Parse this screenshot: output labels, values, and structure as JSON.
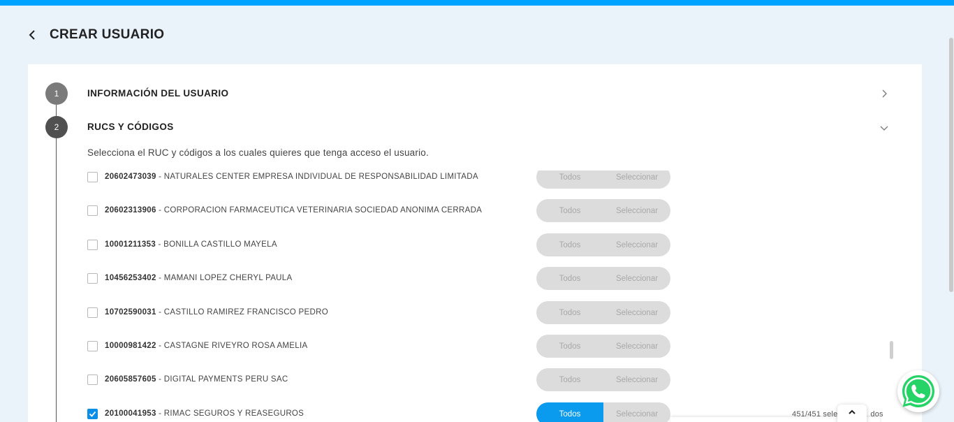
{
  "header": {
    "title": "CREAR USUARIO"
  },
  "steps": [
    {
      "number": "1",
      "title": "INFORMACIÓN DEL USUARIO"
    },
    {
      "number": "2",
      "title": "RUCS Y CÓDIGOS"
    }
  ],
  "rucs_section": {
    "description": "Selecciona el RUC y códigos a los cuales quieres que tenga acceso el usuario.",
    "toggle_labels": {
      "all": "Todos",
      "select": "Seleccionar"
    },
    "rows": [
      {
        "ruc": "20602473039",
        "name": " - NATURALES CENTER EMPRESA INDIVIDUAL DE RESPONSABILIDAD LIMITADA",
        "checked": false,
        "mode": ""
      },
      {
        "ruc": "20602313906",
        "name": " - CORPORACION FARMACEUTICA VETERINARIA SOCIEDAD ANONIMA CERRADA",
        "checked": false,
        "mode": ""
      },
      {
        "ruc": "10001211353",
        "name": " - BONILLA CASTILLO MAYELA",
        "checked": false,
        "mode": ""
      },
      {
        "ruc": "10456253402",
        "name": " - MAMANI LOPEZ CHERYL PAULA",
        "checked": false,
        "mode": ""
      },
      {
        "ruc": "10702590031",
        "name": " - CASTILLO RAMIREZ FRANCISCO PEDRO",
        "checked": false,
        "mode": ""
      },
      {
        "ruc": "10000981422",
        "name": " - CASTAGNE RIVEYRO ROSA AMELIA",
        "checked": false,
        "mode": ""
      },
      {
        "ruc": "20605857605",
        "name": " - DIGITAL PAYMENTS PERU SAC",
        "checked": false,
        "mode": ""
      },
      {
        "ruc": "20100041953",
        "name": " - RIMAC SEGUROS Y REASEGUROS",
        "checked": true,
        "mode": "Todos"
      }
    ],
    "selected_count": "451/451 sele",
    "selected_count_tail": "dos"
  },
  "colors": {
    "accent": "#00a3ff",
    "toggle_active": "#0a9aee",
    "whatsapp": "#25d366"
  },
  "icons": {
    "back": "chevron-left-icon",
    "collapsed": "chevron-right-icon",
    "expanded": "chevron-down-icon",
    "scroll_up": "chevron-up-icon",
    "chat": "whatsapp-icon"
  }
}
